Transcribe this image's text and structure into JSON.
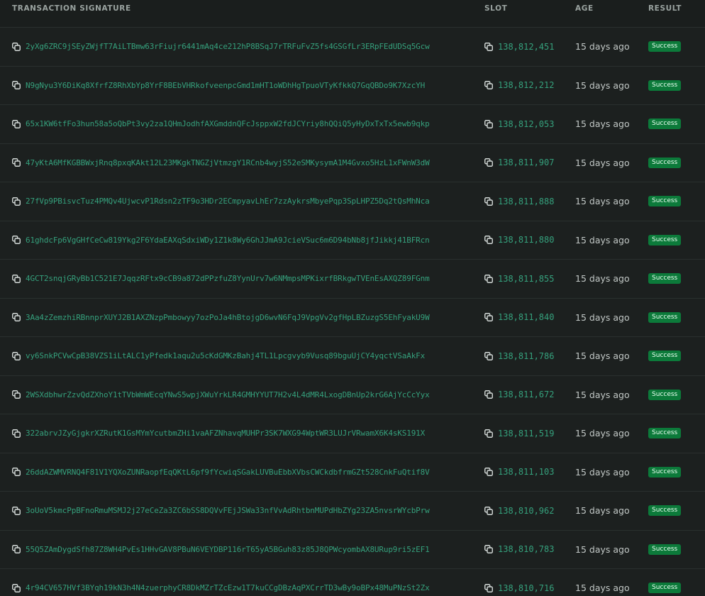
{
  "columns": {
    "signature": "Transaction Signature",
    "slot": "Slot",
    "age": "Age",
    "result": "Result"
  },
  "colors": {
    "link": "#35a07c",
    "success_badge": "#0c7a3a",
    "background": "#1a1e1d"
  },
  "rows": [
    {
      "signature": "2yXg6ZRC9jSEyZWjfT7AiLTBmw63rFiujr6441mAq4ce212hP8BSqJ7rTRFuFvZ5fs4GSGfLr3ERpFEdUDSq5Gcw",
      "slot": "138,812,451",
      "age": "15 days ago",
      "result": "Success"
    },
    {
      "signature": "N9gNyu3Y6DiKq8XfrfZ8RhXbYp8YrF8BEbVHRkofveenpcGmd1mHT1oWDhHgTpuoVTyKfkkQ7GqQBDo9K7XzcYH",
      "slot": "138,812,212",
      "age": "15 days ago",
      "result": "Success"
    },
    {
      "signature": "65x1KW6tfFo3hun58a5oQbPt3vy2za1QHmJodhfAXGmddnQFcJsppxW2fdJCYriy8hQQiQ5yHyDxTxTx5ewb9qkp",
      "slot": "138,812,053",
      "age": "15 days ago",
      "result": "Success"
    },
    {
      "signature": "47yKtA6MfKGBBWxjRnq8pxqKAkt12L23MKgkTNGZjVtmzgY1RCnb4wyjS52eSMKysymA1M4Gvxo5HzL1xFWnW3dW",
      "slot": "138,811,907",
      "age": "15 days ago",
      "result": "Success"
    },
    {
      "signature": "27fVp9PBisvcTuz4PMQv4UjwcvP1Rdsn2zTF9o3HDr2ECmpyavLhEr7zzAykrsMbyePqp3SpLHPZ5Dq2tQsMhNca",
      "slot": "138,811,888",
      "age": "15 days ago",
      "result": "Success"
    },
    {
      "signature": "61ghdcFp6VgGHfCeCw819Ykg2F6YdaEAXqSdxiWDy1Z1k8Wy6GhJJmA9JcieVSuc6m6D94bNb8jfJikkj41BFRcn",
      "slot": "138,811,880",
      "age": "15 days ago",
      "result": "Success"
    },
    {
      "signature": "4GCT2snqjGRyBb1C521E7JqqzRFtx9cCB9a872dPPzfuZ8YynUrv7w6NMmpsMPKixrfBRkgwTVEnEsAXQZ89FGnm",
      "slot": "138,811,855",
      "age": "15 days ago",
      "result": "Success"
    },
    {
      "signature": "3Aa4zZemzhiRBnnprXUYJ2B1AXZNzpPmbowyy7ozPoJa4hBtojgD6wvN6FqJ9VpgVv2gfHpLBZuzgS5EhFyakU9W",
      "slot": "138,811,840",
      "age": "15 days ago",
      "result": "Success"
    },
    {
      "signature": "vy6SnkPCVwCpB38VZS1iLtALC1yPfedk1aqu2u5cKdGMKzBahj4TL1Lpcgvyb9Vusq89bguUjCY4yqctVSaAkFx",
      "slot": "138,811,786",
      "age": "15 days ago",
      "result": "Success"
    },
    {
      "signature": "2WSXdbhwrZzvQdZXhoY1tTVbWmWEcqYNwS5wpjXWuYrkLR4GMHYYUT7H2v4L4dMR4LxogDBnUp2krG6AjYcCcYyx",
      "slot": "138,811,672",
      "age": "15 days ago",
      "result": "Success"
    },
    {
      "signature": "322abrvJZyGjgkrXZRutK1GsMYmYcutbmZHi1vaAFZNhavqMUHPr3SK7WXG94WptWR3LUJrVRwamX6K4sKS191X",
      "slot": "138,811,519",
      "age": "15 days ago",
      "result": "Success"
    },
    {
      "signature": "26ddAZWMVRNQ4F81V1YQXoZUNRaopfEqQKtL6pf9fYcwiqSGakLUVBuEbbXVbsCWCkdbfrmGZt528CnkFuQtif8V",
      "slot": "138,811,103",
      "age": "15 days ago",
      "result": "Success"
    },
    {
      "signature": "3oUoV5kmcPpBFnoRmuMSMJ2j27eCeZa3ZC6bSS8DQVvFEjJSWa33nfVvAdRhtbnMUPdHbZYg23ZA5nvsrWYcbPrw",
      "slot": "138,810,962",
      "age": "15 days ago",
      "result": "Success"
    },
    {
      "signature": "55Q5ZAmDygdSfh87Z8WH4PvEs1HHvGAV8PBuN6VEYDBP116rT65yA5BGuh83z85J8QPWcyombAX8URup9ri5zEF1",
      "slot": "138,810,783",
      "age": "15 days ago",
      "result": "Success"
    },
    {
      "signature": "4r94CV657HVf3BYqh19kN3h4N4zuerphyCR8DkMZrTZcEzw1T7kuCCgDBzAqPXCrrTD3wBy9oBPx48MuPNzSt2Zx",
      "slot": "138,810,716",
      "age": "15 days ago",
      "result": "Success"
    }
  ]
}
